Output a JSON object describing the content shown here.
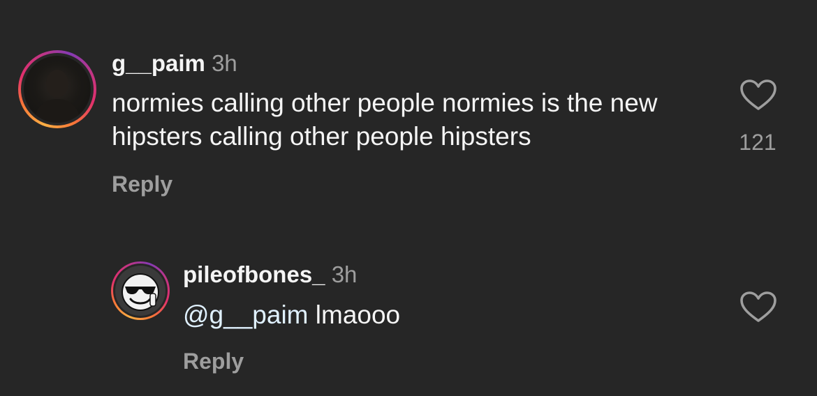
{
  "comments": [
    {
      "username": "g__paim",
      "time": "3h",
      "text": "normies calling other people normies is the new hipsters calling other people hipsters",
      "reply_label": "Reply",
      "likes": "121",
      "icons": {
        "like": "heart-outline-icon",
        "avatar": "profile-photo"
      }
    },
    {
      "username": "pileofbones_",
      "time": "3h",
      "mention": "@g__paim",
      "text": "lmaooo",
      "reply_label": "Reply",
      "icons": {
        "like": "heart-outline-icon",
        "avatar": "sunglasses-smiley-avatar"
      }
    }
  ],
  "colors": {
    "background": "#262626",
    "primary_text": "#f5f5f5",
    "secondary_text": "#9e9e9e",
    "mention": "#e0f1ff",
    "story_ring_start": "#fcaf45",
    "story_ring_end": "#c13584"
  }
}
